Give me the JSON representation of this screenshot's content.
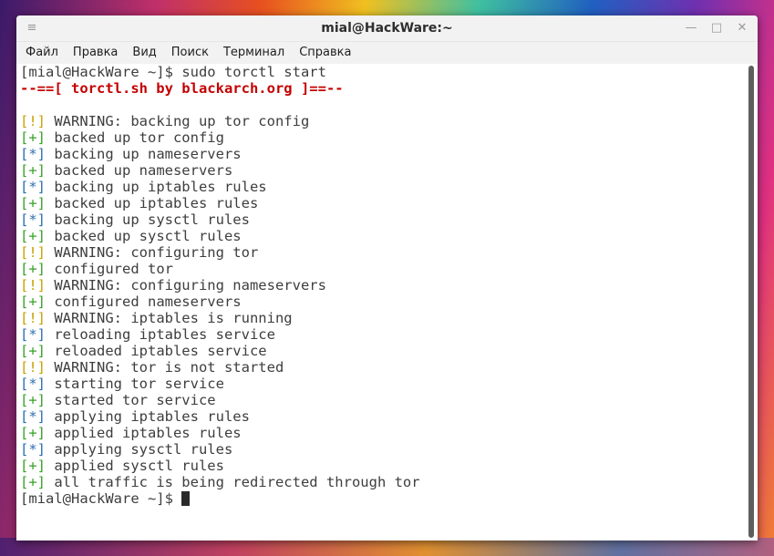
{
  "window": {
    "title": "mial@HackWare:~",
    "menu_icon": "≡",
    "minimize_label": "—",
    "maximize_label": "□",
    "close_label": "✕"
  },
  "menu": {
    "items": [
      "Файл",
      "Правка",
      "Вид",
      "Поиск",
      "Терминал",
      "Справка"
    ]
  },
  "terminal": {
    "prompt": "[mial@HackWare ~]$ ",
    "command": "sudo torctl start",
    "banner": "--==[ torctl.sh by blackarch.org ]==--",
    "lines": [
      {
        "symbol": "[!]",
        "kind": "warn",
        "text": " WARNING: backing up tor config"
      },
      {
        "symbol": "[+]",
        "kind": "ok",
        "text": " backed up tor config"
      },
      {
        "symbol": "[*]",
        "kind": "info",
        "text": " backing up nameservers"
      },
      {
        "symbol": "[+]",
        "kind": "ok",
        "text": " backed up nameservers"
      },
      {
        "symbol": "[*]",
        "kind": "info",
        "text": " backing up iptables rules"
      },
      {
        "symbol": "[+]",
        "kind": "ok",
        "text": " backed up iptables rules"
      },
      {
        "symbol": "[*]",
        "kind": "info",
        "text": " backing up sysctl rules"
      },
      {
        "symbol": "[+]",
        "kind": "ok",
        "text": " backed up sysctl rules"
      },
      {
        "symbol": "[!]",
        "kind": "warn",
        "text": " WARNING: configuring tor"
      },
      {
        "symbol": "[+]",
        "kind": "ok",
        "text": " configured tor"
      },
      {
        "symbol": "[!]",
        "kind": "warn",
        "text": " WARNING: configuring nameservers"
      },
      {
        "symbol": "[+]",
        "kind": "ok",
        "text": " configured nameservers"
      },
      {
        "symbol": "[!]",
        "kind": "warn",
        "text": " WARNING: iptables is running"
      },
      {
        "symbol": "[*]",
        "kind": "info",
        "text": " reloading iptables service"
      },
      {
        "symbol": "[+]",
        "kind": "ok",
        "text": " reloaded iptables service"
      },
      {
        "symbol": "[!]",
        "kind": "warn",
        "text": " WARNING: tor is not started"
      },
      {
        "symbol": "[*]",
        "kind": "info",
        "text": " starting tor service"
      },
      {
        "symbol": "[+]",
        "kind": "ok",
        "text": " started tor service"
      },
      {
        "symbol": "[*]",
        "kind": "info",
        "text": " applying iptables rules"
      },
      {
        "symbol": "[+]",
        "kind": "ok",
        "text": " applied iptables rules"
      },
      {
        "symbol": "[*]",
        "kind": "info",
        "text": " applying sysctl rules"
      },
      {
        "symbol": "[+]",
        "kind": "ok",
        "text": " applied sysctl rules"
      },
      {
        "symbol": "[+]",
        "kind": "ok",
        "text": " all traffic is being redirected through tor"
      }
    ],
    "final_prompt": "[mial@HackWare ~]$ "
  },
  "colors": {
    "banner": "#c40000",
    "warn": "#c8a000",
    "ok": "#3aa02a",
    "info": "#2f6fb0",
    "text": "#3e3e3e"
  }
}
